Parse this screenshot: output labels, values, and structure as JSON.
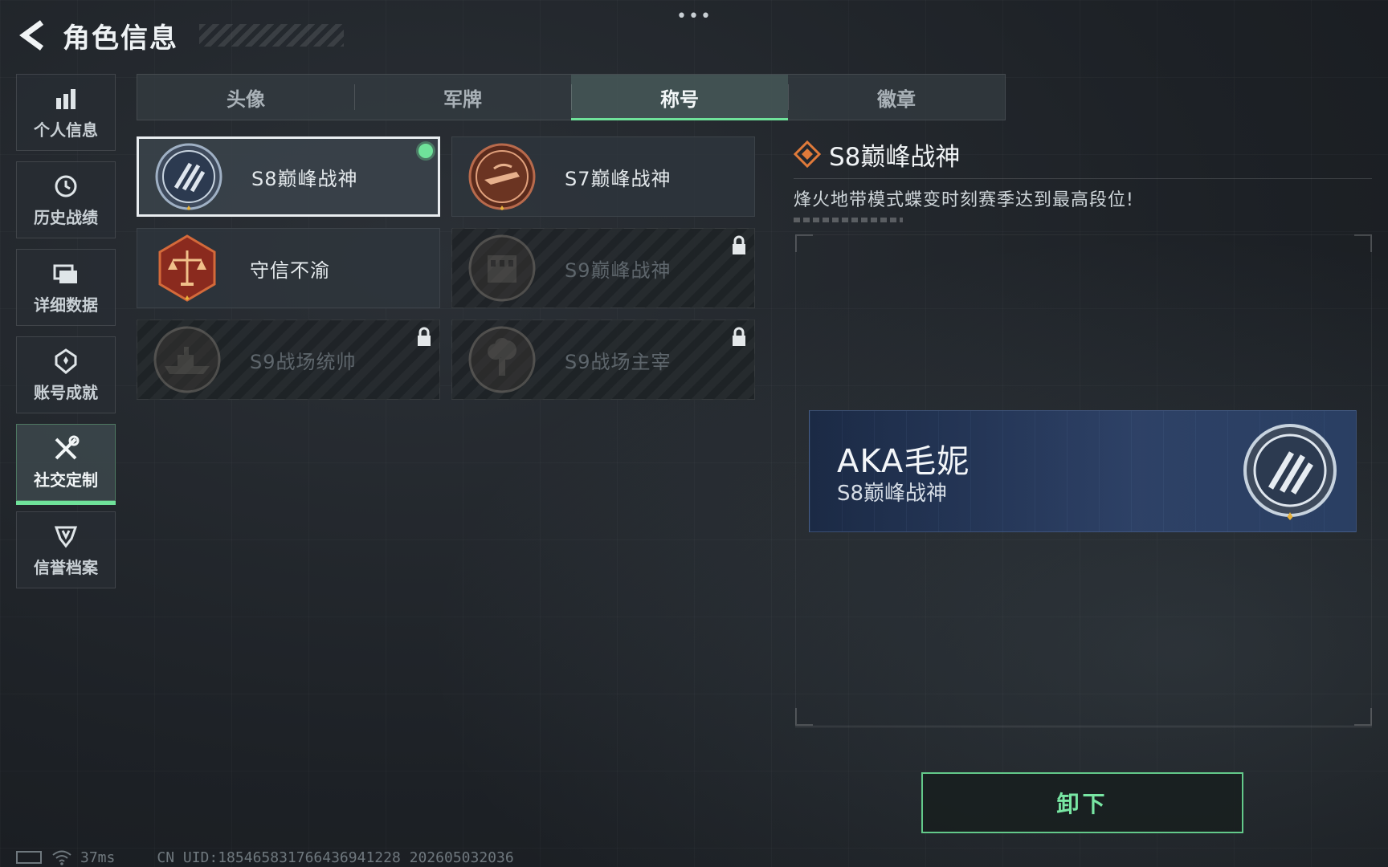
{
  "header": {
    "title": "角色信息",
    "menu_dots": "•••"
  },
  "sidebar": {
    "items": [
      {
        "label": "个人信息",
        "icon": "bar-chart-icon",
        "active": false
      },
      {
        "label": "历史战绩",
        "icon": "history-clock-icon",
        "active": false
      },
      {
        "label": "详细数据",
        "icon": "folder-icon",
        "active": false
      },
      {
        "label": "账号成就",
        "icon": "achievement-badge-icon",
        "active": false
      },
      {
        "label": "社交定制",
        "icon": "tools-wrench-icon",
        "active": true
      },
      {
        "label": "信誉档案",
        "icon": "credit-shield-icon",
        "active": false
      }
    ]
  },
  "tabs": [
    {
      "label": "头像",
      "active": false
    },
    {
      "label": "军牌",
      "active": false
    },
    {
      "label": "称号",
      "active": true
    },
    {
      "label": "徽章",
      "active": false
    }
  ],
  "titles": [
    {
      "label": "S8巅峰战神",
      "medal": "s8-peak-medal-icon",
      "selected": true,
      "equipped": true,
      "locked": false
    },
    {
      "label": "S7巅峰战神",
      "medal": "s7-peak-medal-icon",
      "selected": false,
      "equipped": false,
      "locked": false
    },
    {
      "label": "守信不渝",
      "medal": "scales-justice-medal-icon",
      "selected": false,
      "equipped": false,
      "locked": false
    },
    {
      "label": "S9巅峰战神",
      "medal": "s9-peak-medal-icon",
      "selected": false,
      "equipped": false,
      "locked": true
    },
    {
      "label": "S9战场统帅",
      "medal": "battleship-medal-icon",
      "selected": false,
      "equipped": false,
      "locked": true
    },
    {
      "label": "S9战场主宰",
      "medal": "mushroom-cloud-medal-icon",
      "selected": false,
      "equipped": false,
      "locked": true
    }
  ],
  "detail": {
    "name": "S8巅峰战神",
    "description": "烽火地带模式蝶变时刻赛季达到最高段位!"
  },
  "preview": {
    "player_name": "AKA毛妮",
    "title": "S8巅峰战神"
  },
  "actions": {
    "unequip_label": "卸下"
  },
  "status_bar": {
    "ping": "37ms",
    "uid": "CN UID:185465831766436941228 202605032036"
  },
  "colors": {
    "accent_green": "#6fe29a",
    "title_diamond": "#e07a3a",
    "nameplate_blue": "#223356"
  }
}
